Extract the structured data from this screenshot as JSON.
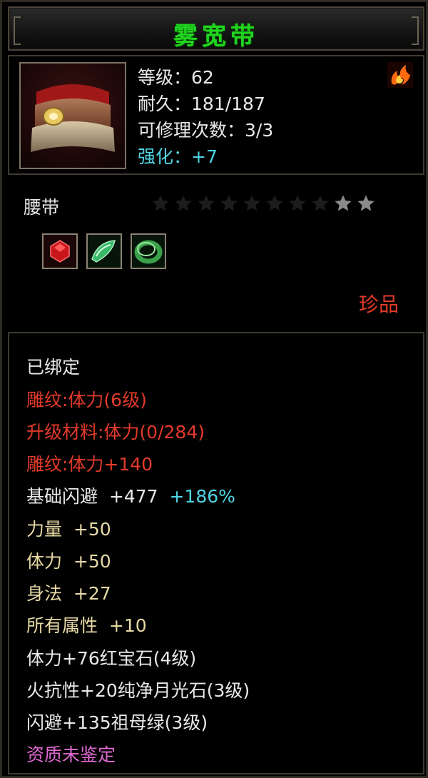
{
  "title": "雾宽带",
  "stats": {
    "level": "等级：62",
    "durability": "耐久：181/187",
    "repair": "可修理次数：3/3",
    "enhance": "强化：+7"
  },
  "item_type": "腰带",
  "stars_lit": 2,
  "stars_total": 10,
  "rarity": "珍品",
  "gems": [
    {
      "icon": "ruby-gem-icon"
    },
    {
      "icon": "emerald-shard-icon"
    },
    {
      "icon": "jade-ring-icon"
    }
  ],
  "attributes": {
    "bound": "已绑定",
    "engrave": "雕纹:体力(6级)",
    "upgrade_material": "升级材料:体力(0/284)",
    "engrave_bonus": "雕纹:体力+140",
    "base_dodge_label": "基础闪避",
    "base_dodge_value": "+477",
    "base_dodge_pct": "+186%",
    "strength_label": "力量",
    "strength_value": "+50",
    "vitality_label": "体力",
    "vitality_value": "+50",
    "agility_label": "身法",
    "agility_value": "+27",
    "all_attr_label": "所有属性",
    "all_attr_value": "+10",
    "gem1": "体力+76红宝石(4级)",
    "gem2": "火抗性+20纯净月光石(3级)",
    "gem3": "闪避+135祖母绿(3级)",
    "aptitude": "资质未鉴定"
  }
}
